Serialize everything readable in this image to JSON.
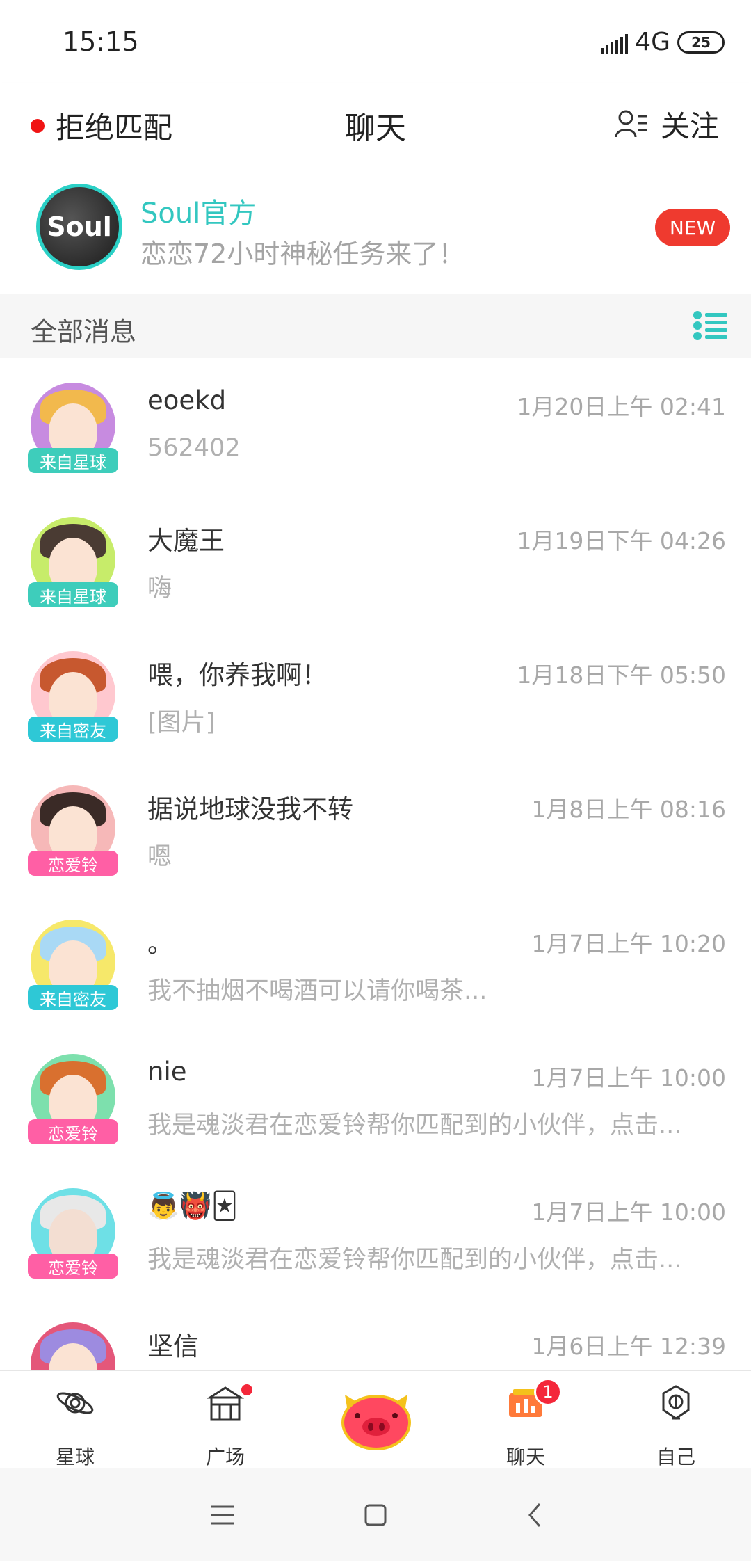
{
  "status": {
    "time": "15:15",
    "network": "4G",
    "battery": "25"
  },
  "header": {
    "reject_label": "拒绝匹配",
    "title": "聊天",
    "follow_label": "关注"
  },
  "official": {
    "avatar_text": "Soul",
    "name": "Soul官方",
    "message": "恋恋72小时神秘任务来了！",
    "badge": "NEW"
  },
  "section": {
    "title": "全部消息"
  },
  "chats": [
    {
      "name": "eoekd",
      "time": "1月20日上午 02:41",
      "preview": "562402",
      "tag": "来自星球"
    },
    {
      "name": "大魔王",
      "time": "1月19日下午 04:26",
      "preview": "嗨",
      "tag": "来自星球"
    },
    {
      "name": "喂，你养我啊！",
      "time": "1月18日下午 05:50",
      "preview": "[图片]",
      "tag": "来自密友"
    },
    {
      "name": "据说地球没我不转",
      "time": "1月8日上午 08:16",
      "preview": "嗯",
      "tag": "恋爱铃"
    },
    {
      "name": "。",
      "time": "1月7日上午 10:20",
      "preview": "我不抽烟不喝酒可以请你喝茶...",
      "tag": "来自密友"
    },
    {
      "name": "nie",
      "time": "1月7日上午 10:00",
      "preview": "我是魂淡君在恋爱铃帮你匹配到的小伙伴，点击...",
      "tag": "恋爱铃"
    },
    {
      "name": "👼👹🃏",
      "time": "1月7日上午 10:00",
      "preview": "我是魂淡君在恋爱铃帮你匹配到的小伙伴，点击...",
      "tag": "恋爱铃"
    },
    {
      "name": "坚信",
      "time": "1月6日上午 12:39",
      "preview": "",
      "tag": ""
    }
  ],
  "nav": {
    "planet": "星球",
    "square": "广场",
    "chat": "聊天",
    "chat_badge": "1",
    "me": "自己"
  },
  "colors": {
    "accent": "#33c7c0",
    "badge_red": "#ef3a2f",
    "tag_planet": "#3ecdbb",
    "tag_friend": "#2ec8d6",
    "tag_love": "#ff5fa5"
  }
}
